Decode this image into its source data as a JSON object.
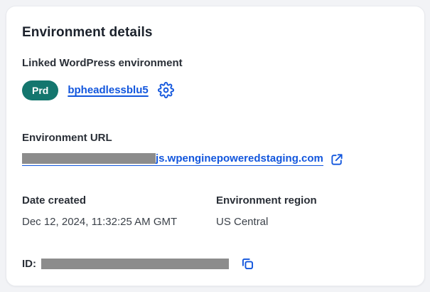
{
  "card": {
    "title": "Environment details",
    "linked_environment": {
      "label": "Linked WordPress environment",
      "badge": "Prd",
      "environment_name": "bpheadlessblu5"
    },
    "environment_url": {
      "label": "Environment URL",
      "visible_url_suffix": "js.wpenginepoweredstaging.com",
      "prefix_redacted": true
    },
    "date_created": {
      "label": "Date created",
      "value": "Dec 12, 2024, 11:32:25 AM GMT"
    },
    "environment_region": {
      "label": "Environment region",
      "value": "US Central"
    },
    "id_row": {
      "label": "ID:",
      "value_redacted": true
    }
  },
  "icons": {
    "gear": "gear-icon",
    "external_link": "external-link-icon",
    "copy": "copy-icon"
  },
  "colors": {
    "badge": "#14766e",
    "link": "#1256dd",
    "redaction": "#8c8c8c",
    "heading": "#1b212b",
    "label": "#2a2f37",
    "value": "#3c424a"
  }
}
